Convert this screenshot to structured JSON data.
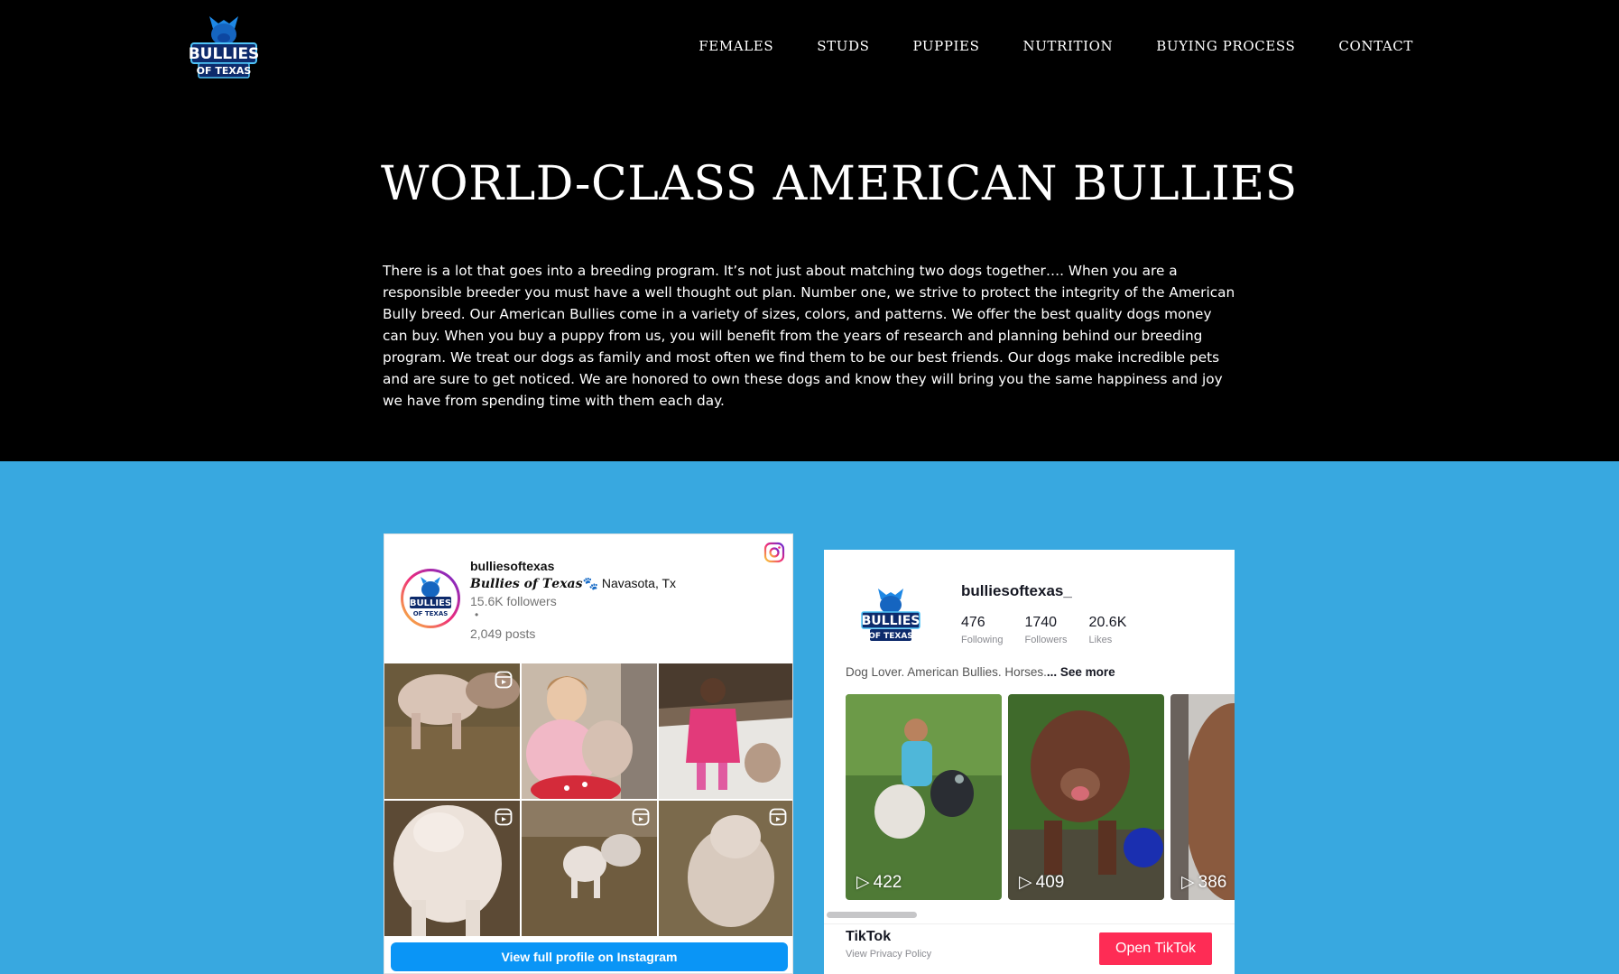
{
  "header": {
    "logo_alt": "Bullies of Texas",
    "nav": [
      {
        "label": "FEMALES"
      },
      {
        "label": "STUDS"
      },
      {
        "label": "PUPPIES"
      },
      {
        "label": "NUTRITION"
      },
      {
        "label": "BUYING PROCESS"
      },
      {
        "label": "CONTACT"
      }
    ]
  },
  "hero": {
    "title": "WORLD-CLASS AMERICAN BULLIES",
    "text": "There is a lot that goes into a breeding program. It’s not just about matching two dogs together…. When you are a responsible breeder you must have a well thought out plan. Number one, we strive to protect the integrity of the American Bully breed. Our American Bullies come in a variety of sizes, colors, and patterns. We offer the best quality dogs money can buy. When you buy a puppy from us, you will benefit from the years of research and planning behind our breeding program. We treat our dogs as family and most often we find them to be our best friends. Our dogs make incredible pets and are sure to get noticed. We are honored to own these dogs and know they will bring you the same happiness and joy we have from spending time with them each day."
  },
  "instagram": {
    "handle": "bulliesoftexas",
    "bio_name": "𝑩𝒖𝒍𝒍𝒊𝒆𝒔 𝒐𝒇 𝑻𝒆𝒙𝒂𝒔",
    "bio_paw": "🐾",
    "bio_location": " Navasota, Tx",
    "followers": "15.6K followers",
    "dot": "•",
    "posts": "2,049 posts",
    "button_label": "View full profile on Instagram"
  },
  "tiktok": {
    "handle": "bulliesoftexas_",
    "stats": [
      {
        "value": "476",
        "label": "Following"
      },
      {
        "value": "1740",
        "label": "Followers"
      },
      {
        "value": "20.6K",
        "label": "Likes"
      }
    ],
    "description": "Dog Lover. American Bullies. Horses.",
    "see_more": "... See more",
    "videos": [
      {
        "plays": "422"
      },
      {
        "plays": "409"
      },
      {
        "plays": "386"
      }
    ],
    "brand": "TikTok",
    "privacy": "View Privacy Policy",
    "open_label": "Open TikTok"
  },
  "colors": {
    "band": "#38a8e0",
    "ig_button": "#0a95f6",
    "tiktok_button": "#fe2c55"
  }
}
